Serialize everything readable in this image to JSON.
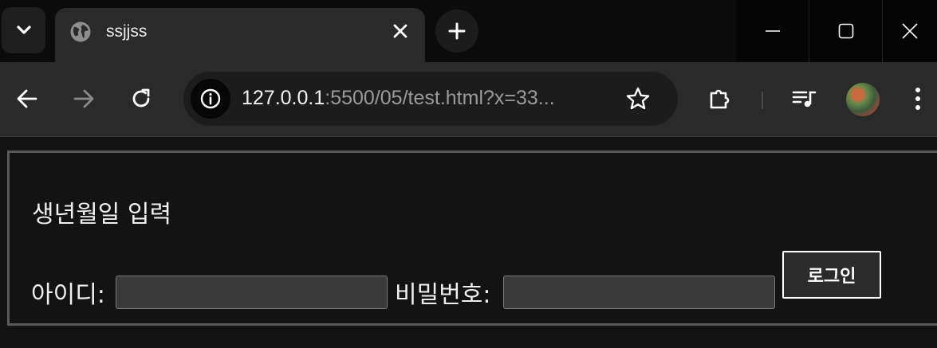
{
  "browser": {
    "tab": {
      "title": "ssjjss"
    },
    "address_bar": {
      "host": "127.0.0.1",
      "rest": ":5500/05/test.html?x=33..."
    }
  },
  "icons": {
    "tab_search": "chevron-down-icon",
    "favicon": "globe-icon",
    "tab_close": "close-icon",
    "new_tab": "plus-icon",
    "back": "arrow-left-icon",
    "forward": "arrow-right-icon",
    "reload": "reload-icon",
    "site_info": "info-icon",
    "bookmark": "star-icon",
    "extensions": "puzzle-icon",
    "media": "playlist-music-icon",
    "menu": "kebab-menu-icon"
  },
  "page": {
    "legend": "생년월일 입력",
    "id_label": "아이디:",
    "password_label": "비밀번호:",
    "id_value": "",
    "password_value": "",
    "login_button": "로그인"
  }
}
